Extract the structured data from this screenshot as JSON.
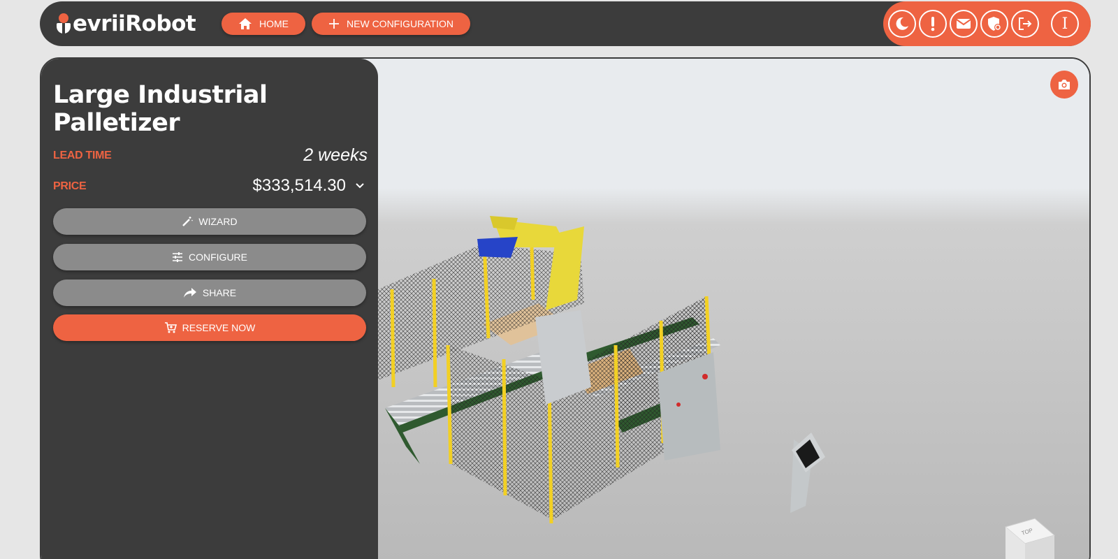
{
  "header": {
    "logo_text": "evriiRobot",
    "home_label": "HOME",
    "new_config_label": "NEW CONFIGURATION",
    "avatar_initial": "I",
    "icons": [
      "moon-icon",
      "alert-icon",
      "mail-icon",
      "shield-icon",
      "logout-icon"
    ]
  },
  "product": {
    "title": "Large Industrial Palletizer",
    "lead_time_label": "LEAD TIME",
    "lead_time_value": "2 weeks",
    "price_label": "PRICE",
    "price_value": "$333,514.30"
  },
  "actions": {
    "wizard_label": "WIZARD",
    "configure_label": "CONFIGURE",
    "share_label": "SHARE",
    "reserve_label": "RESERVE NOW"
  },
  "viewport": {
    "cube_label": "TOP"
  },
  "colors": {
    "accent": "#ee6342",
    "panel": "#3c3c3c",
    "secondary_button": "#8b8b8b",
    "robot": "#e8d83a",
    "fence_post": "#f2d024",
    "conveyor_frame": "#2f5a2f"
  }
}
